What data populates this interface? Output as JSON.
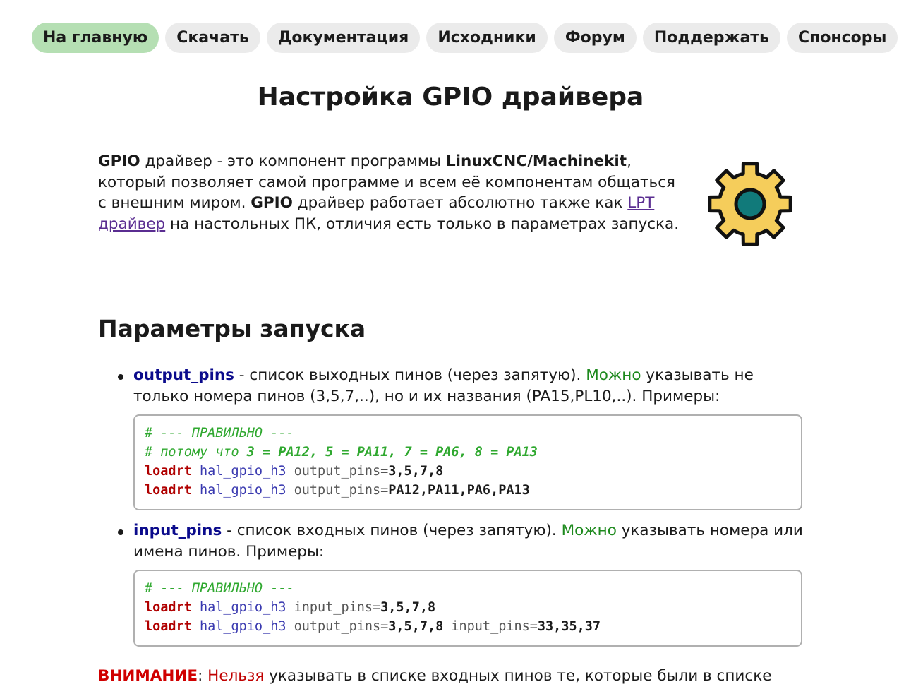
{
  "nav": {
    "items": [
      {
        "label": "На главную",
        "active": true
      },
      {
        "label": "Скачать"
      },
      {
        "label": "Документация"
      },
      {
        "label": "Исходники"
      },
      {
        "label": "Форум"
      },
      {
        "label": "Поддержать"
      },
      {
        "label": "Спонсоры"
      }
    ]
  },
  "page_title": "Настройка GPIO драйвера",
  "intro": {
    "gpio1": "GPIO",
    "t1": " драйвер - это компонент программы ",
    "program": "LinuxCNC/Machinekit",
    "t2": ", который позволяет самой программе и всем её компонентам общаться с внешним миром. ",
    "gpio2": "GPIO",
    "t3": " драйвер работает абсолютно также как ",
    "link": "LPT драйвер",
    "t4": " на настольных ПК, отличия есть только в параметрах запуска."
  },
  "gear_icon": {
    "outer": "#f5cd5b",
    "inner": "#117a7a",
    "stroke": "#111111"
  },
  "section_title": "Параметры запуска",
  "params": {
    "output": {
      "name": "output_pins",
      "t1": " - список выходных пинов (через запятую). ",
      "can": "Можно",
      "t2": " указывать не только номера пинов (3,5,7,..), но и их названия (PA15,PL10,..). Примеры:",
      "code": {
        "c1": "# --- ПРАВИЛЬНО ---",
        "c2a": "# потому что ",
        "c2b": "3 = PA12, 5 = PA11, 7 = PA6, 8 = PA13",
        "l1_kw": "loadrt",
        "l1_mod": " hal_gpio_h3",
        "l1_arg": " output_pins=",
        "l1_val": "3,5,7,8",
        "l2_kw": "loadrt",
        "l2_mod": " hal_gpio_h3",
        "l2_arg": " output_pins=",
        "l2_val": "PA12,PA11,PA6,PA13"
      }
    },
    "input": {
      "name": "input_pins",
      "t1": " - список входных пинов (через запятую). ",
      "can": "Можно",
      "t2": " указывать номера или имена пинов. Примеры:",
      "code": {
        "c1": "# --- ПРАВИЛЬНО ---",
        "l1_kw": "loadrt",
        "l1_mod": " hal_gpio_h3",
        "l1_arg": " input_pins=",
        "l1_val": "3,5,7,8",
        "l2_kw": "loadrt",
        "l2_mod": " hal_gpio_h3",
        "l2_arg1": " output_pins=",
        "l2_val1": "3,5,7,8",
        "l2_arg2": " input_pins=",
        "l2_val2": "33,35,37"
      }
    }
  },
  "warning": {
    "label": "ВНИМАНИЕ",
    "colon": ": ",
    "cannot": "Нельзя",
    "text": " указывать в списке входных пинов те, которые были в списке"
  }
}
